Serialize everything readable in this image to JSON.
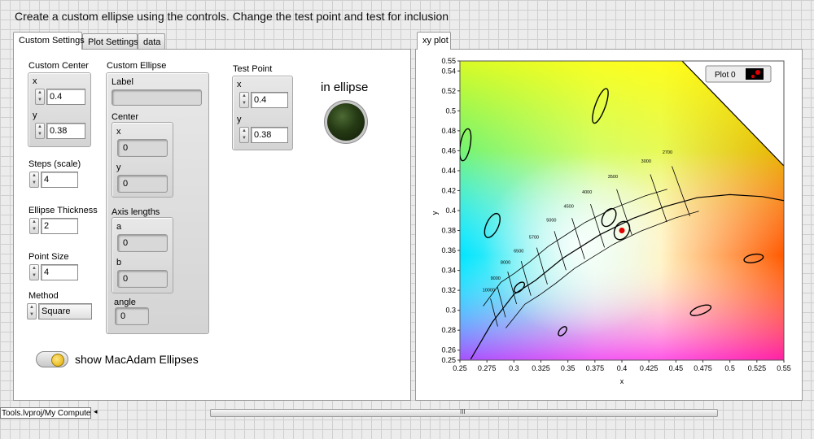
{
  "header": {
    "instructions": "Create a custom ellipse using the controls. Change the test point and test for inclusion"
  },
  "left_tabs": [
    "Custom Settings",
    "Plot Settings",
    "data"
  ],
  "right_tabs": [
    "xy plot"
  ],
  "custom_center": {
    "title": "Custom Center",
    "x_label": "x",
    "x_value": "0.4",
    "y_label": "y",
    "y_value": "0.38"
  },
  "steps": {
    "label": "Steps (scale)",
    "value": "4"
  },
  "ellipse_thickness": {
    "label": "Ellipse Thickness",
    "value": "2"
  },
  "point_size": {
    "label": "Point Size",
    "value": "4"
  },
  "method": {
    "label": "Method",
    "value": "Square"
  },
  "custom_ellipse": {
    "title": "Custom Ellipse",
    "label_label": "Label",
    "label_value": "",
    "center_label": "Center",
    "cx_label": "x",
    "cx_value": "0",
    "cy_label": "y",
    "cy_value": "0",
    "axis_label": "Axis lengths",
    "a_label": "a",
    "a_value": "0",
    "b_label": "b",
    "b_value": "0",
    "angle_label": "angle",
    "angle_value": "0"
  },
  "test_point": {
    "title": "Test Point",
    "x_label": "x",
    "x_value": "0.4",
    "y_label": "y",
    "y_value": "0.38"
  },
  "indicator": {
    "label": "in ellipse",
    "state": "off",
    "color": "#2b4019"
  },
  "macadam": {
    "label": "show MacAdam Ellipses",
    "state": "off"
  },
  "status_bar": {
    "path": "Tools.lvproj/My Computer",
    "scroll_grip": "III"
  },
  "chart_data": {
    "type": "scatter",
    "title": "",
    "legend": {
      "label": "Plot 0",
      "placement": "top-right"
    },
    "xlabel": "x",
    "ylabel": "y",
    "xlim": [
      0.25,
      0.55
    ],
    "ylim": [
      0.25,
      0.55
    ],
    "x_ticks": [
      "0.25",
      "0.275",
      "0.3",
      "0.325",
      "0.35",
      "0.375",
      "0.4",
      "0.425",
      "0.45",
      "0.475",
      "0.5",
      "0.525",
      "0.55"
    ],
    "y_ticks": [
      "0.25",
      "0.26",
      "0.28",
      "0.3",
      "0.32",
      "0.34",
      "0.36",
      "0.38",
      "0.4",
      "0.42",
      "0.44",
      "0.46",
      "0.48",
      "0.5",
      "0.52",
      "0.54",
      "0.55"
    ],
    "test_point": {
      "x": 0.4,
      "y": 0.38,
      "color": "#e00000"
    },
    "cct_labels": [
      "10000",
      "9000",
      "8000",
      "6500",
      "5700",
      "5000",
      "4500",
      "4000",
      "3500",
      "3000",
      "2700"
    ],
    "planckian_locus": [
      [
        0.26,
        0.251
      ],
      [
        0.28,
        0.288
      ],
      [
        0.3,
        0.316
      ],
      [
        0.32,
        0.33
      ],
      [
        0.345,
        0.352
      ],
      [
        0.38,
        0.376
      ],
      [
        0.41,
        0.392
      ],
      [
        0.44,
        0.404
      ],
      [
        0.47,
        0.413
      ],
      [
        0.5,
        0.416
      ],
      [
        0.53,
        0.414
      ],
      [
        0.55,
        0.41
      ]
    ],
    "macadam_ellipses": [
      {
        "cx": 0.255,
        "cy": 0.466,
        "a": 0.015,
        "b": 0.005,
        "angle": -80
      },
      {
        "cx": 0.28,
        "cy": 0.385,
        "a": 0.012,
        "b": 0.006,
        "angle": -65
      },
      {
        "cx": 0.305,
        "cy": 0.323,
        "a": 0.006,
        "b": 0.0035,
        "angle": -45
      },
      {
        "cx": 0.345,
        "cy": 0.279,
        "a": 0.005,
        "b": 0.003,
        "angle": -50
      },
      {
        "cx": 0.38,
        "cy": 0.505,
        "a": 0.017,
        "b": 0.005,
        "angle": -70
      },
      {
        "cx": 0.388,
        "cy": 0.393,
        "a": 0.009,
        "b": 0.006,
        "angle": -60
      },
      {
        "cx": 0.4,
        "cy": 0.38,
        "a": 0.009,
        "b": 0.007,
        "angle": -60
      },
      {
        "cx": 0.522,
        "cy": 0.352,
        "a": 0.009,
        "b": 0.004,
        "angle": -10
      },
      {
        "cx": 0.473,
        "cy": 0.3,
        "a": 0.01,
        "b": 0.004,
        "angle": -20
      }
    ]
  }
}
